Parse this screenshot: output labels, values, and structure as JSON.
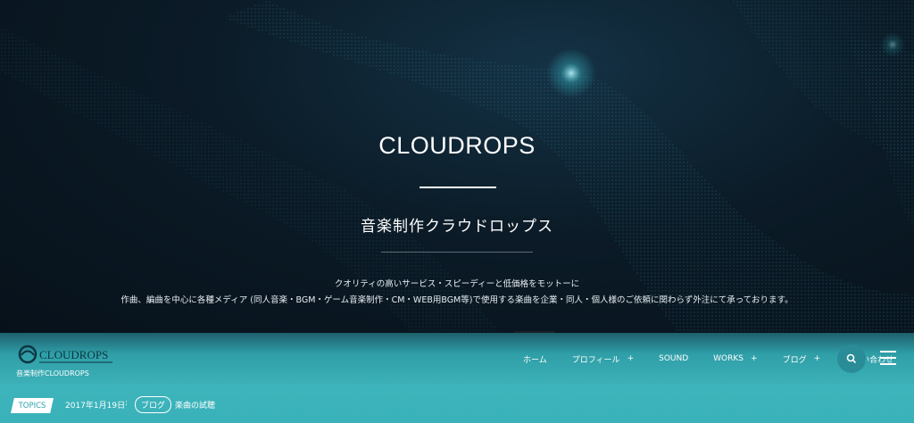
{
  "hero": {
    "title": "CLOUDROPS",
    "subtitle": "音楽制作クラウドロップス",
    "description_line1": "クオリティの高いサービス・スピーディーと低価格をモットーに",
    "description_line2": "作曲、編曲を中心に各種メディア (同人音楽・BGM・ゲーム音楽制作・CM・WEB用BGM等)で使用する楽曲を企業・同人・個人様のご依頼に関わらず外注にて承っております。"
  },
  "header": {
    "logo_text": "CLOUDROPS",
    "logo_subtitle": "音楽制作CLOUDROPS",
    "nav": [
      {
        "label": "ホーム",
        "has_submenu": false
      },
      {
        "label": "プロフィール",
        "has_submenu": true
      },
      {
        "label": "SOUND",
        "has_submenu": false
      },
      {
        "label": "WORKS",
        "has_submenu": true
      },
      {
        "label": "ブログ",
        "has_submenu": true
      },
      {
        "label": "お問い合わせ",
        "has_submenu": false
      }
    ],
    "submenu_marker": "+",
    "search_icon": "search-icon",
    "menu_icon": "hamburger-menu-icon"
  },
  "topics": {
    "badge": "TOPICS",
    "date": "2017年1月19日",
    "separator": ":",
    "category": "ブログ",
    "title": "楽曲の試聴"
  },
  "colors": {
    "hero_bg": "#0b1b27",
    "accent": "#3db1b8",
    "particle": "#3fc8d8"
  }
}
